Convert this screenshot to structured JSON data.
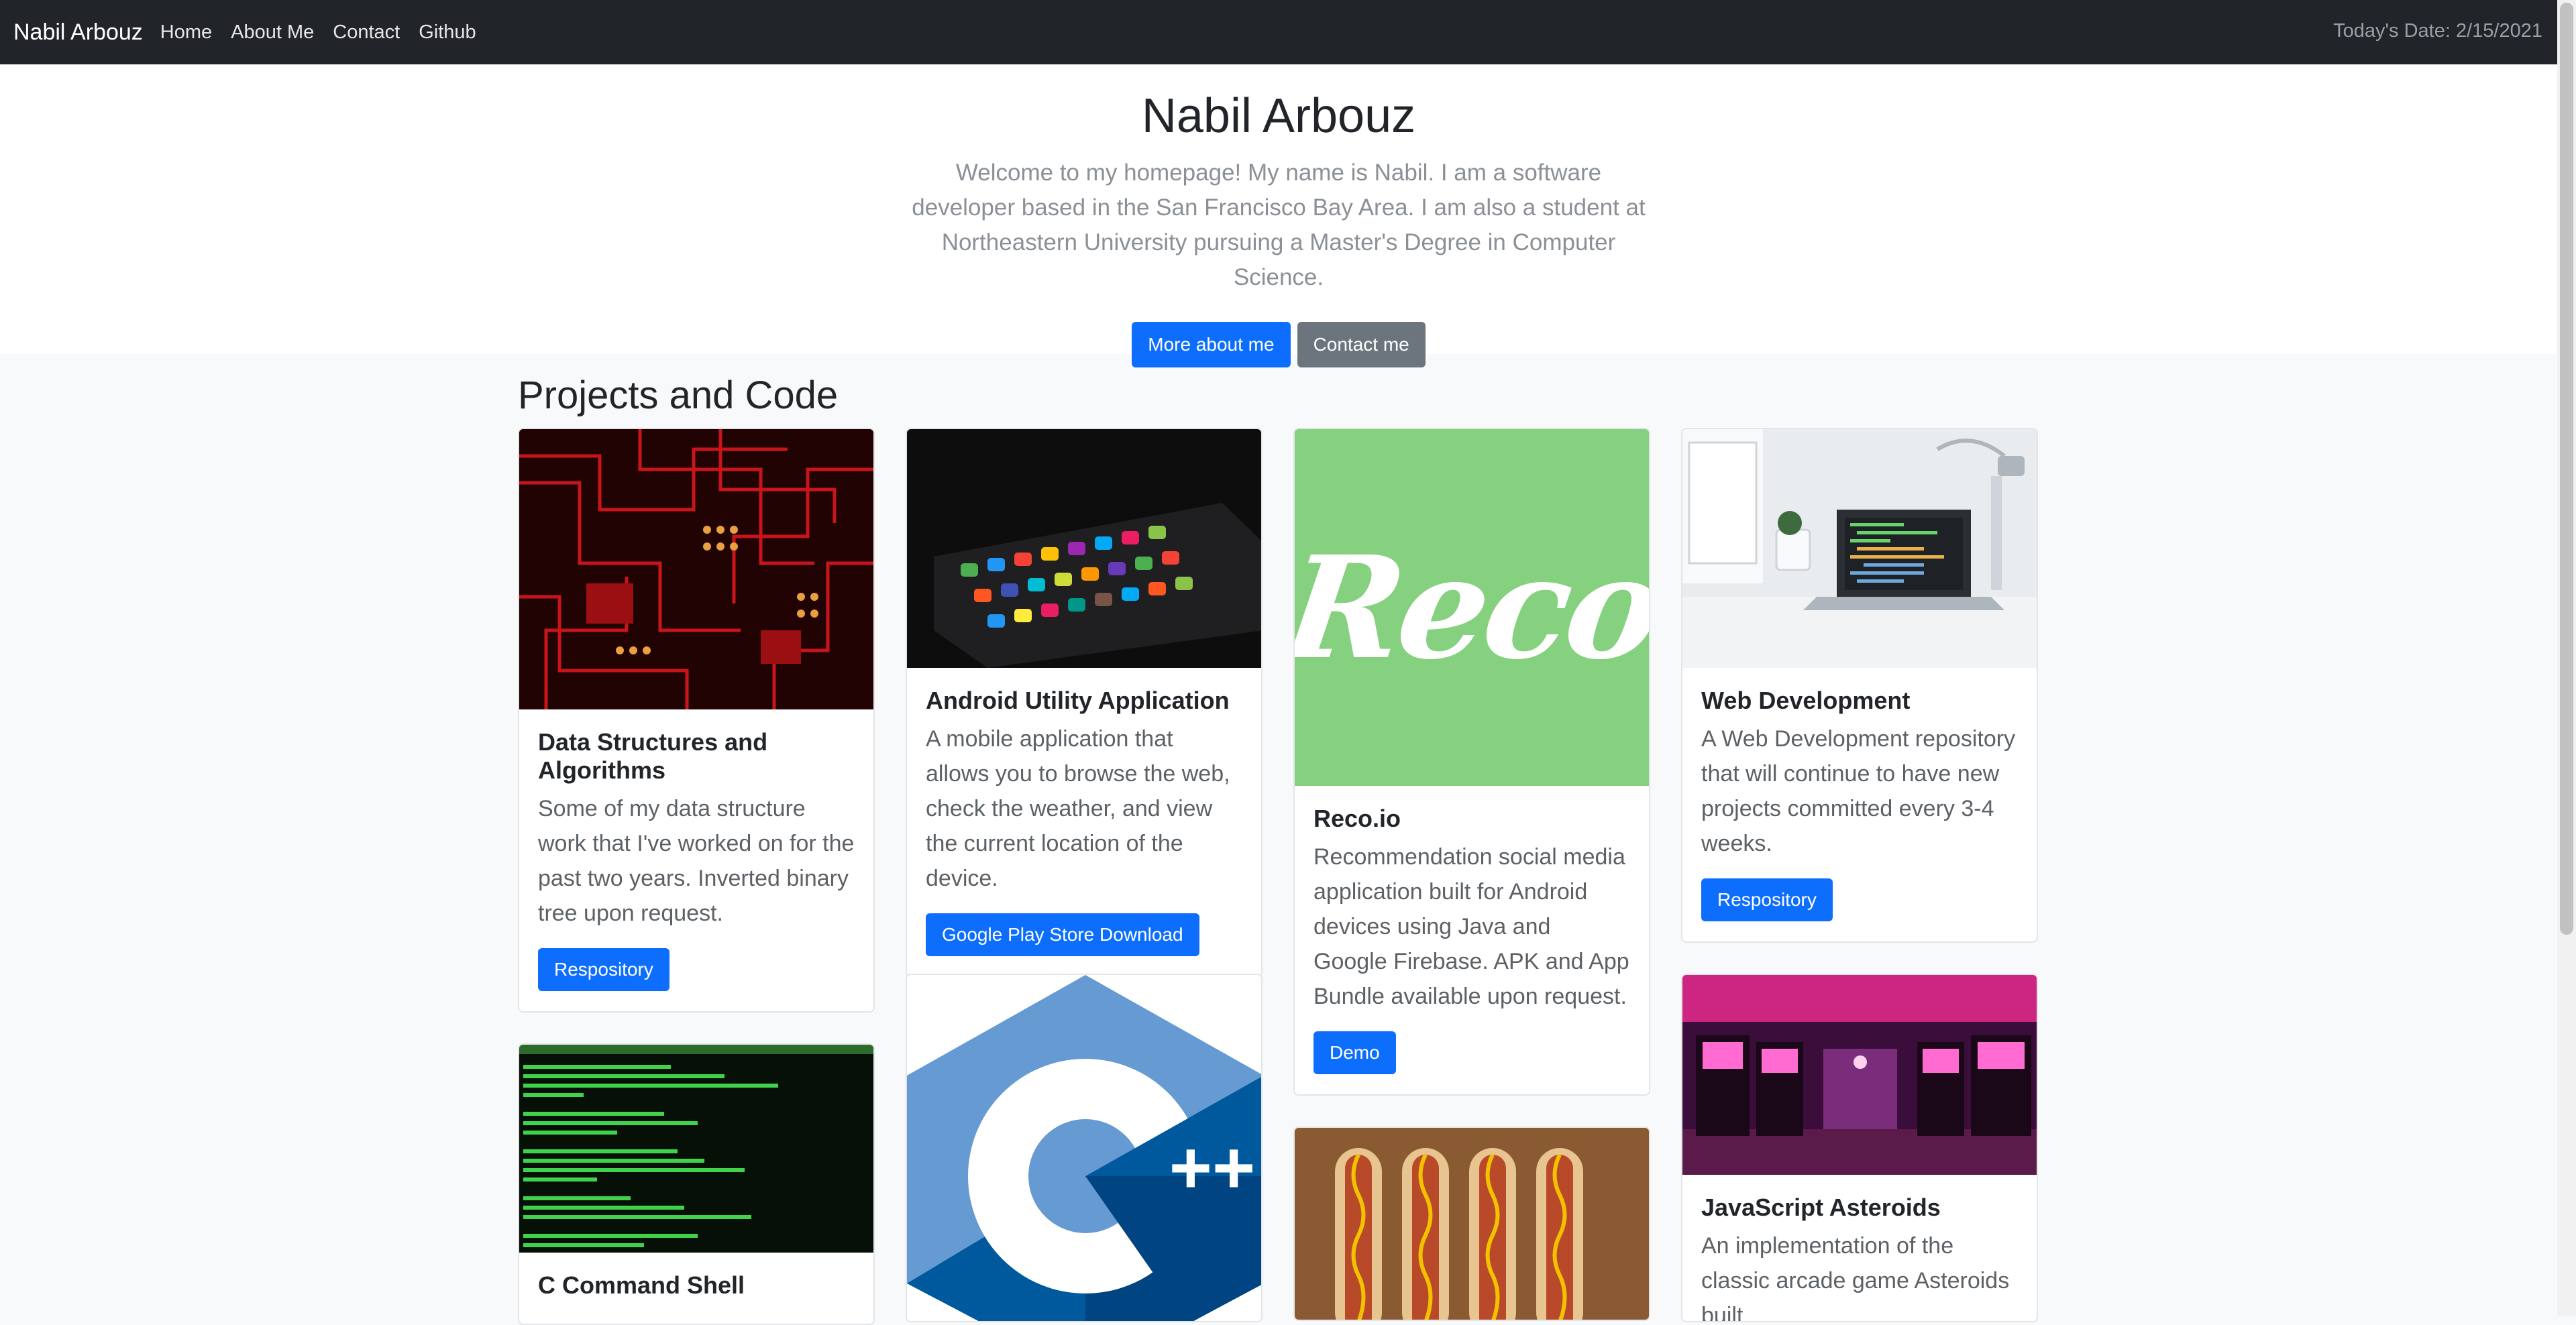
{
  "navbar": {
    "brand": "Nabil Arbouz",
    "links": [
      "Home",
      "About Me",
      "Contact",
      "Github"
    ],
    "date_text": "Today's Date: 2/15/2021"
  },
  "hero": {
    "title": "Nabil Arbouz",
    "lead": "Welcome to my homepage! My name is Nabil. I am a software developer based in the San Francisco Bay Area. I am also a student at Northeastern University pursuing a Master's Degree in Computer Science.",
    "primary_button": "More about me",
    "secondary_button": "Contact me"
  },
  "projects": {
    "heading": "Projects and Code",
    "cards": [
      {
        "title": "Data Structures and Algorithms",
        "text": "Some of my data structure work that I've worked on for the past two years. Inverted binary tree upon request.",
        "button": "Respository"
      },
      {
        "title": "Android Utility Application",
        "text": "A mobile application that allows you to browse the web, check the weather, and view the current location of the device.",
        "button": "Google Play Store Download"
      },
      {
        "title": "Reco.io",
        "text": "Recommendation social media application built for Android devices using Java and Google Firebase. APK and App Bundle available upon request.",
        "button": "Demo",
        "logo_text": "Reco"
      },
      {
        "title": "Web Development",
        "text": "A Web Development repository that will continue to have new projects committed every 3-4 weeks.",
        "button": "Respository"
      },
      {
        "title": "C Command Shell"
      },
      {
        "logo_text": "++"
      },
      {},
      {
        "title": "JavaScript Asteroids",
        "text": "An implementation of the classic arcade game Asteroids built"
      }
    ]
  },
  "colors": {
    "navbar_bg": "#212529",
    "primary": "#0d6efd",
    "secondary": "#6c757d",
    "reco_green": "#86d17f"
  }
}
